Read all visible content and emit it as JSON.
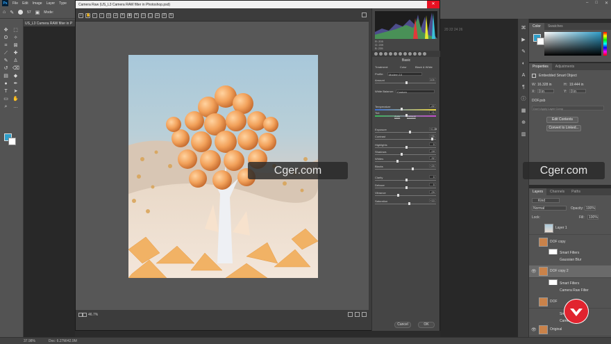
{
  "menubar": {
    "logo": "Ps",
    "items": [
      "File",
      "Edit",
      "Image",
      "Layer",
      "Type"
    ],
    "controls": [
      "–",
      "□",
      "✕"
    ]
  },
  "options_bar": {
    "mode_label": "Mode:",
    "brush_size": "57"
  },
  "doc_tab": {
    "title": "US_L3 Camera RAW filter in P"
  },
  "ruler": {
    "numbers": "20   22   24   26"
  },
  "camera_raw": {
    "title": "Camera Raw (US_L3 Camera RAW filter in Photoshop.psd)",
    "close": "✕",
    "zoom": "46.7%",
    "cancel": "Cancel",
    "ok": "OK",
    "rgb_readout": {
      "r_label": "R:",
      "r_val": "205",
      "g_label": "G:",
      "g_val": "209",
      "b_label": "B:",
      "b_val": "235"
    },
    "panel_header": "Basic",
    "treatment_label": "Treatment:",
    "treatment_color": "Color",
    "treatment_bw": "Black & White",
    "profile_label": "Profile:",
    "profile_value": "Modern 10",
    "amount_label": "Amount",
    "amount_value": "100",
    "wb_label": "White Balance:",
    "wb_value": "Custom",
    "auto": "Auto",
    "default": "Default",
    "sliders": [
      {
        "label": "Temperature",
        "value": "-22",
        "pos": 0.42
      },
      {
        "label": "Tint",
        "value": "+1",
        "pos": 0.5
      },
      {
        "label": "Exposure",
        "value": "+0.35",
        "pos": 0.56
      },
      {
        "label": "Contrast",
        "value": "+90",
        "pos": 0.92
      },
      {
        "label": "Highlights",
        "value": "0",
        "pos": 0.5
      },
      {
        "label": "Shadows",
        "value": "-18",
        "pos": 0.42
      },
      {
        "label": "Whites",
        "value": "-32",
        "pos": 0.35
      },
      {
        "label": "Blacks",
        "value": "+20",
        "pos": 0.6
      },
      {
        "label": "Clarity",
        "value": "0",
        "pos": 0.5
      },
      {
        "label": "Dehaze",
        "value": "0",
        "pos": 0.5
      },
      {
        "label": "Vibrance",
        "value": "-29",
        "pos": 0.36
      },
      {
        "label": "Saturation",
        "value": "+10",
        "pos": 0.55
      }
    ]
  },
  "right_panels": {
    "color_tab": "Color",
    "swatches_tab": "Swatches",
    "properties_tab": "Properties",
    "adjustments_tab": "Adjustments",
    "embedded_label": "Embedded Smart Object",
    "w_label": "W:",
    "w_value": "16.328 in",
    "h_label": "H:",
    "h_value": "19.444 in",
    "x_label": "X:",
    "x_value": "0 in",
    "y_label": "Y:",
    "y_value": "0 in",
    "file_name": "DOF.psb",
    "comps_placeholder": "Don't Apply Layer Comp",
    "edit_contents": "Edit Contents",
    "convert_linked": "Convert to Linked...",
    "layers_tab": "Layers",
    "channels_tab": "Channels",
    "paths_tab": "Paths",
    "kind_label": "Kind",
    "blend_mode": "Normal",
    "opacity_label": "Opacity:",
    "opacity_value": "100%",
    "lock_label": "Lock:",
    "fill_label": "Fill:",
    "fill_value": "100%",
    "layers": [
      "Layer 1",
      "DOF copy",
      "Smart Filters",
      "Gaussian Blur",
      "DOF copy 2",
      "Smart Filters",
      "Camera Raw Filter",
      "DOF",
      "Sm",
      "Camera",
      "Original"
    ]
  },
  "statusbar": {
    "zoom": "37.98%",
    "doc": "Doc: 6.27M/42.9M"
  },
  "watermarks": [
    "Cger.com",
    "Cger.com"
  ]
}
